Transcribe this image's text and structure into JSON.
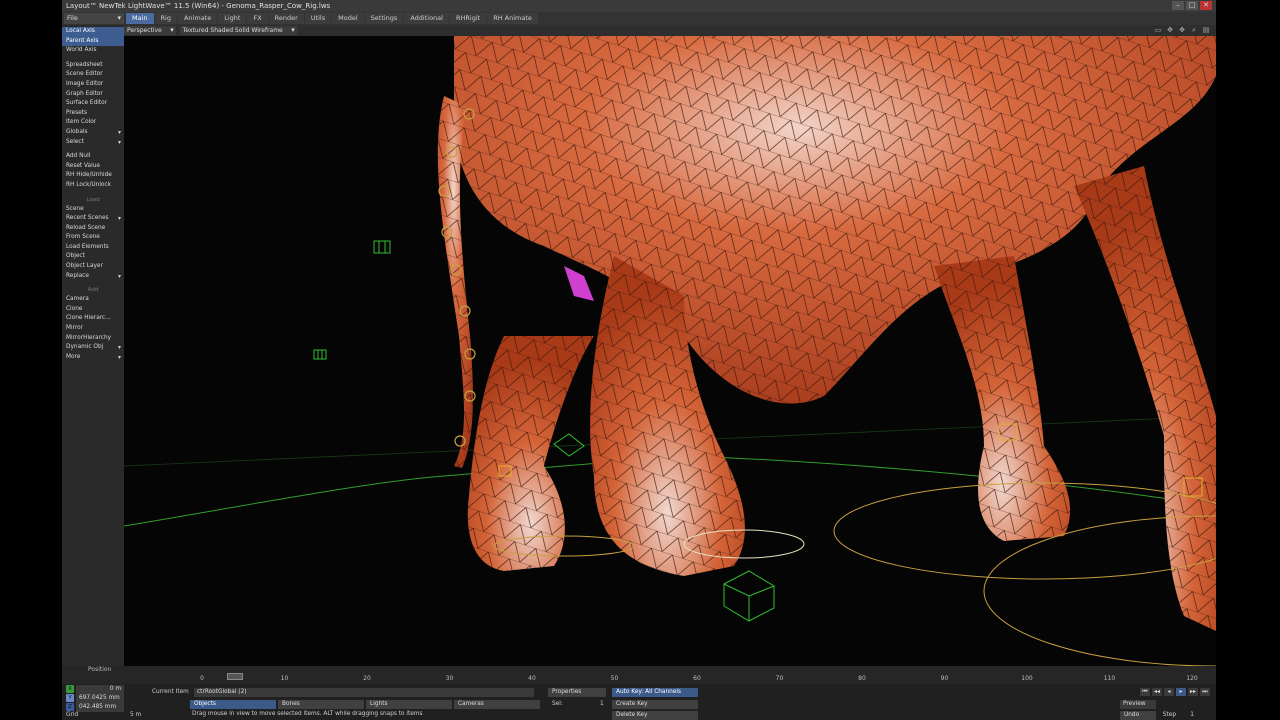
{
  "window": {
    "title": "Layout™ NewTek LightWave™ 11.5 (Win64) - Genoma_Rasper_Cow_Rig.lws",
    "controls": [
      "–",
      "□",
      "✕"
    ]
  },
  "menubar": {
    "file_label": "File",
    "tabs": [
      {
        "label": "Main"
      },
      {
        "label": "Rig"
      },
      {
        "label": "Animate"
      },
      {
        "label": "Light"
      },
      {
        "label": "FX"
      },
      {
        "label": "Render"
      },
      {
        "label": "Utils"
      },
      {
        "label": "Model"
      },
      {
        "label": "Settings"
      },
      {
        "label": "Additional"
      },
      {
        "label": "RHRigit"
      },
      {
        "label": "RH Animate"
      }
    ],
    "active_tab": "Main"
  },
  "viewport_header": {
    "view_mode": "Perspective",
    "render_mode": "Textured Shaded Solid Wireframe"
  },
  "toolbar": {
    "items": [
      {
        "label": "Local Axis",
        "type": "item",
        "highlight": true
      },
      {
        "label": "Parent Axis",
        "type": "item",
        "highlight": true
      },
      {
        "label": "World Axis",
        "type": "item",
        "highlight": false
      },
      {
        "label": "",
        "type": "spacer"
      },
      {
        "label": "Spreadsheet",
        "type": "item"
      },
      {
        "label": "Scene Editor",
        "type": "item"
      },
      {
        "label": "Image Editor",
        "type": "item"
      },
      {
        "label": "Graph Editor",
        "type": "item"
      },
      {
        "label": "Surface Editor",
        "type": "item"
      },
      {
        "label": "Presets",
        "type": "item"
      },
      {
        "label": "Item Color",
        "type": "item"
      },
      {
        "label": "Globals",
        "type": "dropdown"
      },
      {
        "label": "Select",
        "type": "dropdown"
      },
      {
        "label": "",
        "type": "spacer"
      },
      {
        "label": "Add Null",
        "type": "item"
      },
      {
        "label": "Reset Value",
        "type": "item"
      },
      {
        "label": "RH Hide/Unhide",
        "type": "item"
      },
      {
        "label": "RH Lock/Unlock",
        "type": "item"
      },
      {
        "label": "",
        "type": "spacer"
      },
      {
        "label": "Load",
        "type": "group"
      },
      {
        "label": "Scene",
        "type": "item"
      },
      {
        "label": "Recent Scenes",
        "type": "dropdown"
      },
      {
        "label": "Reload Scene",
        "type": "item"
      },
      {
        "label": "From Scene",
        "type": "item"
      },
      {
        "label": "Load Elements",
        "type": "item"
      },
      {
        "label": "Object",
        "type": "item"
      },
      {
        "label": "Object Layer",
        "type": "item"
      },
      {
        "label": "Replace",
        "type": "dropdown"
      },
      {
        "label": "",
        "type": "spacer"
      },
      {
        "label": "Add",
        "type": "group"
      },
      {
        "label": "Camera",
        "type": "item"
      },
      {
        "label": "Clone",
        "type": "item"
      },
      {
        "label": "Clone Hierarc...",
        "type": "item"
      },
      {
        "label": "Mirror",
        "type": "item"
      },
      {
        "label": "MirrorHierarchy",
        "type": "item"
      },
      {
        "label": "Dynamic Obj",
        "type": "dropdown"
      },
      {
        "label": "More",
        "type": "dropdown"
      }
    ]
  },
  "timeline": {
    "position_label": "Position",
    "ticks": [
      "0",
      "10",
      "20",
      "30",
      "40",
      "50",
      "60",
      "70",
      "80",
      "90",
      "100",
      "110",
      "120"
    ],
    "min_frame": 0,
    "max_frame": 120,
    "current_frame": 4
  },
  "bottom_panel": {
    "x_value": "0 m",
    "y_value": "697.0425 mm",
    "z_value": "042.485 mm",
    "grid_label": "Grid",
    "grid_value": "5 m",
    "axis_labels": [
      "X",
      "Y",
      "Z"
    ],
    "current_item_label": "Current Item",
    "current_item_value": "ctrRootGlobal (2)",
    "item_types": [
      "Objects",
      "Bones",
      "Lights",
      "Cameras"
    ],
    "active_item_type": "Objects",
    "properties_label": "Properties",
    "sel_label": "Sel:",
    "sel_value": "1",
    "auto_key_label": "Auto Key: All Channels",
    "create_key_label": "Create Key",
    "delete_key_label": "Delete Key",
    "status_message": "Drag mouse in view to move selected items. ALT while dragging snaps to items",
    "preview_label": "Preview",
    "undo_label": "Undo",
    "step_label": "Step",
    "step_value": "1"
  },
  "colors": {
    "mesh_fill": "#c9522c",
    "mesh_highlight": "#e8b8a8",
    "wire": "#2a120a",
    "ground_line": "#2f9e2f",
    "control_yellow": "#c8a040",
    "ui_accent": "#3d5d90"
  }
}
